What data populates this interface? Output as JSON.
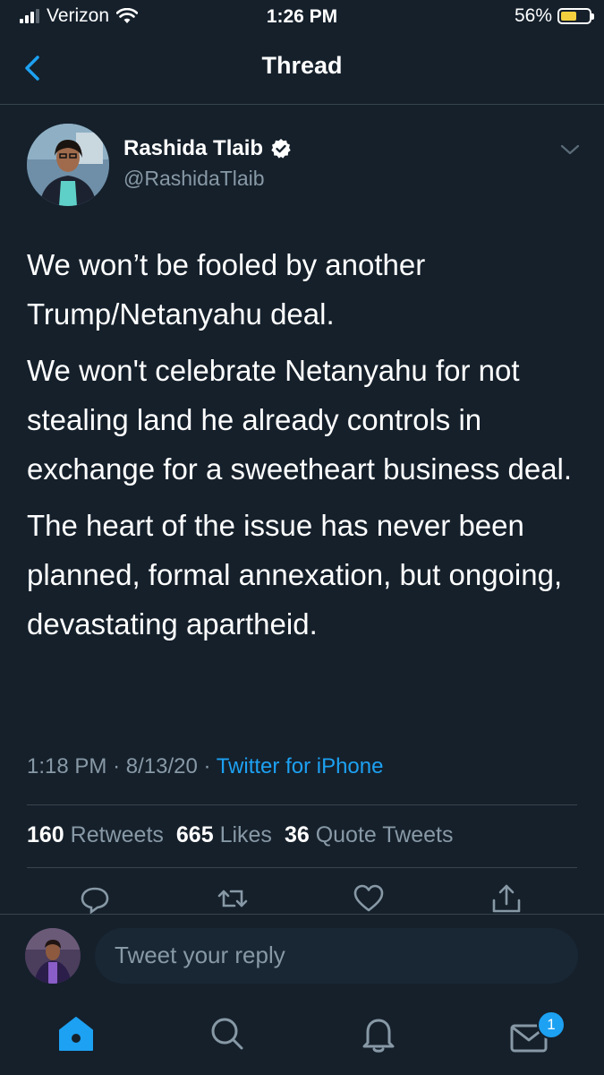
{
  "status_bar": {
    "carrier": "Verizon",
    "time": "1:26 PM",
    "battery_percent": "56%",
    "battery_level": 0.56
  },
  "nav": {
    "title": "Thread"
  },
  "tweet": {
    "author_name": "Rashida Tlaib",
    "author_handle": "@RashidaTlaib",
    "verified": true,
    "paragraphs": [
      "We won’t be fooled by another Trump/Netanyahu deal.",
      "We won't celebrate Netanyahu for not stealing land he already controls in exchange for a sweetheart business deal.",
      "The heart of the issue has never been planned, formal annexation, but ongoing, devastating apartheid."
    ],
    "time": "1:18 PM",
    "date": "8/13/20",
    "separator": "·",
    "source": "Twitter for iPhone",
    "stats": {
      "retweets_count": "160",
      "retweets_label": "Retweets",
      "likes_count": "665",
      "likes_label": "Likes",
      "quotes_count": "36",
      "quotes_label": "Quote Tweets"
    },
    "actions": [
      "reply-icon",
      "retweet-icon",
      "like-icon",
      "share-icon"
    ]
  },
  "reply": {
    "placeholder": "Tweet your reply"
  },
  "tab_bar": {
    "items": [
      "home-icon",
      "search-icon",
      "notifications-icon",
      "messages-icon"
    ],
    "messages_badge": "1"
  },
  "colors": {
    "background": "#15202b",
    "accent": "#1da1f2",
    "secondary_text": "#8899a6",
    "divider": "#38444d"
  }
}
